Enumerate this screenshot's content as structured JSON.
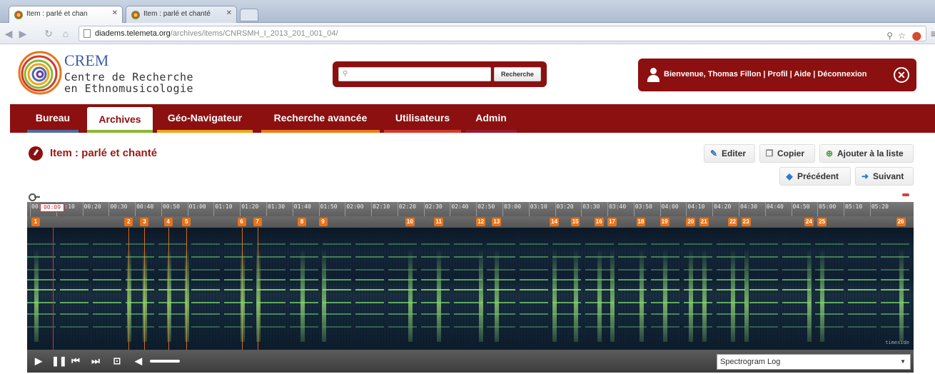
{
  "browser": {
    "tabs": [
      {
        "label": "Item : parlé et chan"
      },
      {
        "label": "Item : parlé et chanté"
      }
    ],
    "url_host": "diadems.telemeta.org",
    "url_path": "/archives/items/CNRSMH_I_2013_201_001_04/"
  },
  "header": {
    "logo_name": "CREM",
    "logo_line1": "Centre de Recherche",
    "logo_line2": "en Ethnomusicologie",
    "search_placeholder": "",
    "search_button": "Recherche",
    "user_text": "Bienvenue, Thomas Fillon | Profil | Aide | Déconnexion"
  },
  "nav": {
    "items": [
      {
        "label": "Bureau",
        "color": "#4f6aa6"
      },
      {
        "label": "Archives",
        "color": "#8ab833"
      },
      {
        "label": "Géo-Navigateur",
        "color": "#f0a41c"
      },
      {
        "label": "Recherche avancée",
        "color": "#ec7a1b"
      },
      {
        "label": "Utilisateurs",
        "color": "#d23a2a"
      },
      {
        "label": "Admin",
        "color": "#9a1a30"
      }
    ]
  },
  "item": {
    "title": "Item : parlé et chanté",
    "actions": {
      "edit": "Editer",
      "copy": "Copier",
      "add_to_list": "Ajouter à la liste",
      "previous": "Précédent",
      "next": "Suivant"
    }
  },
  "player": {
    "current_time": "00:09",
    "ticks": [
      "00:00",
      "00:10",
      "00:20",
      "00:30",
      "00:40",
      "00:50",
      "01:00",
      "01:10",
      "01:20",
      "01:30",
      "01:40",
      "01:50",
      "02:00",
      "02:10",
      "02:20",
      "02:30",
      "02:40",
      "02:50",
      "03:00",
      "03:10",
      "03:20",
      "03:30",
      "03:40",
      "03:50",
      "04:00",
      "04:10",
      "04:20",
      "04:30",
      "04:40",
      "04:50",
      "05:00",
      "05:10",
      "05:20"
    ],
    "markers": [
      {
        "label": "1",
        "t": 0.5
      },
      {
        "label": "2",
        "t": 36
      },
      {
        "label": "3",
        "t": 42
      },
      {
        "label": "4",
        "t": 51
      },
      {
        "label": "5",
        "t": 58
      },
      {
        "label": "6",
        "t": 79
      },
      {
        "label": "7",
        "t": 85
      },
      {
        "label": "8",
        "t": 102
      },
      {
        "label": "9",
        "t": 110
      },
      {
        "label": "10",
        "t": 143
      },
      {
        "label": "11",
        "t": 154
      },
      {
        "label": "12",
        "t": 170
      },
      {
        "label": "13",
        "t": 176
      },
      {
        "label": "14",
        "t": 198
      },
      {
        "label": "15",
        "t": 206
      },
      {
        "label": "16",
        "t": 215
      },
      {
        "label": "17",
        "t": 220
      },
      {
        "label": "18",
        "t": 231
      },
      {
        "label": "19",
        "t": 240
      },
      {
        "label": "20",
        "t": 250
      },
      {
        "label": "21",
        "t": 255
      },
      {
        "label": "22",
        "t": 266
      },
      {
        "label": "23",
        "t": 271
      },
      {
        "label": "24",
        "t": 295
      },
      {
        "label": "25",
        "t": 300
      },
      {
        "label": "26",
        "t": 330
      }
    ],
    "view_mode": "Spectrogram Log",
    "colors": {
      "marker": "#e8741a",
      "playhead": "#e23030",
      "accent": "#8c1010"
    }
  }
}
